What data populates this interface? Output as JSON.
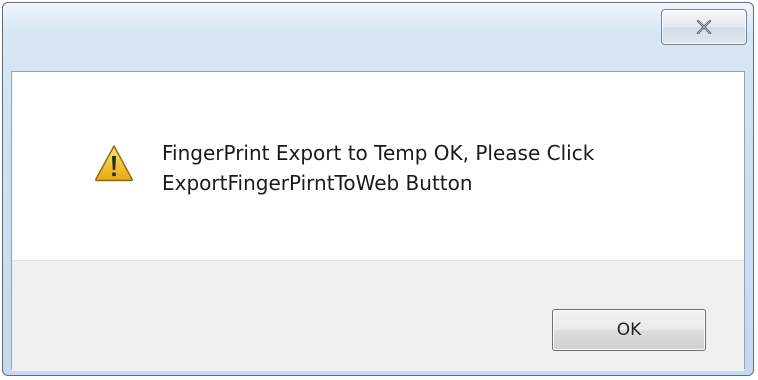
{
  "dialog": {
    "title": "",
    "close_icon": "close-icon",
    "icon": "warning-icon",
    "message_lines": [
      "FingerPrint Export to Temp OK, Please Click",
      "ExportFingerPirntToWeb Button"
    ],
    "ok_label": "OK"
  },
  "colors": {
    "frame": "#cfe0f1",
    "warning_fill": "#f2c21b",
    "footer": "#f0f0f0"
  }
}
